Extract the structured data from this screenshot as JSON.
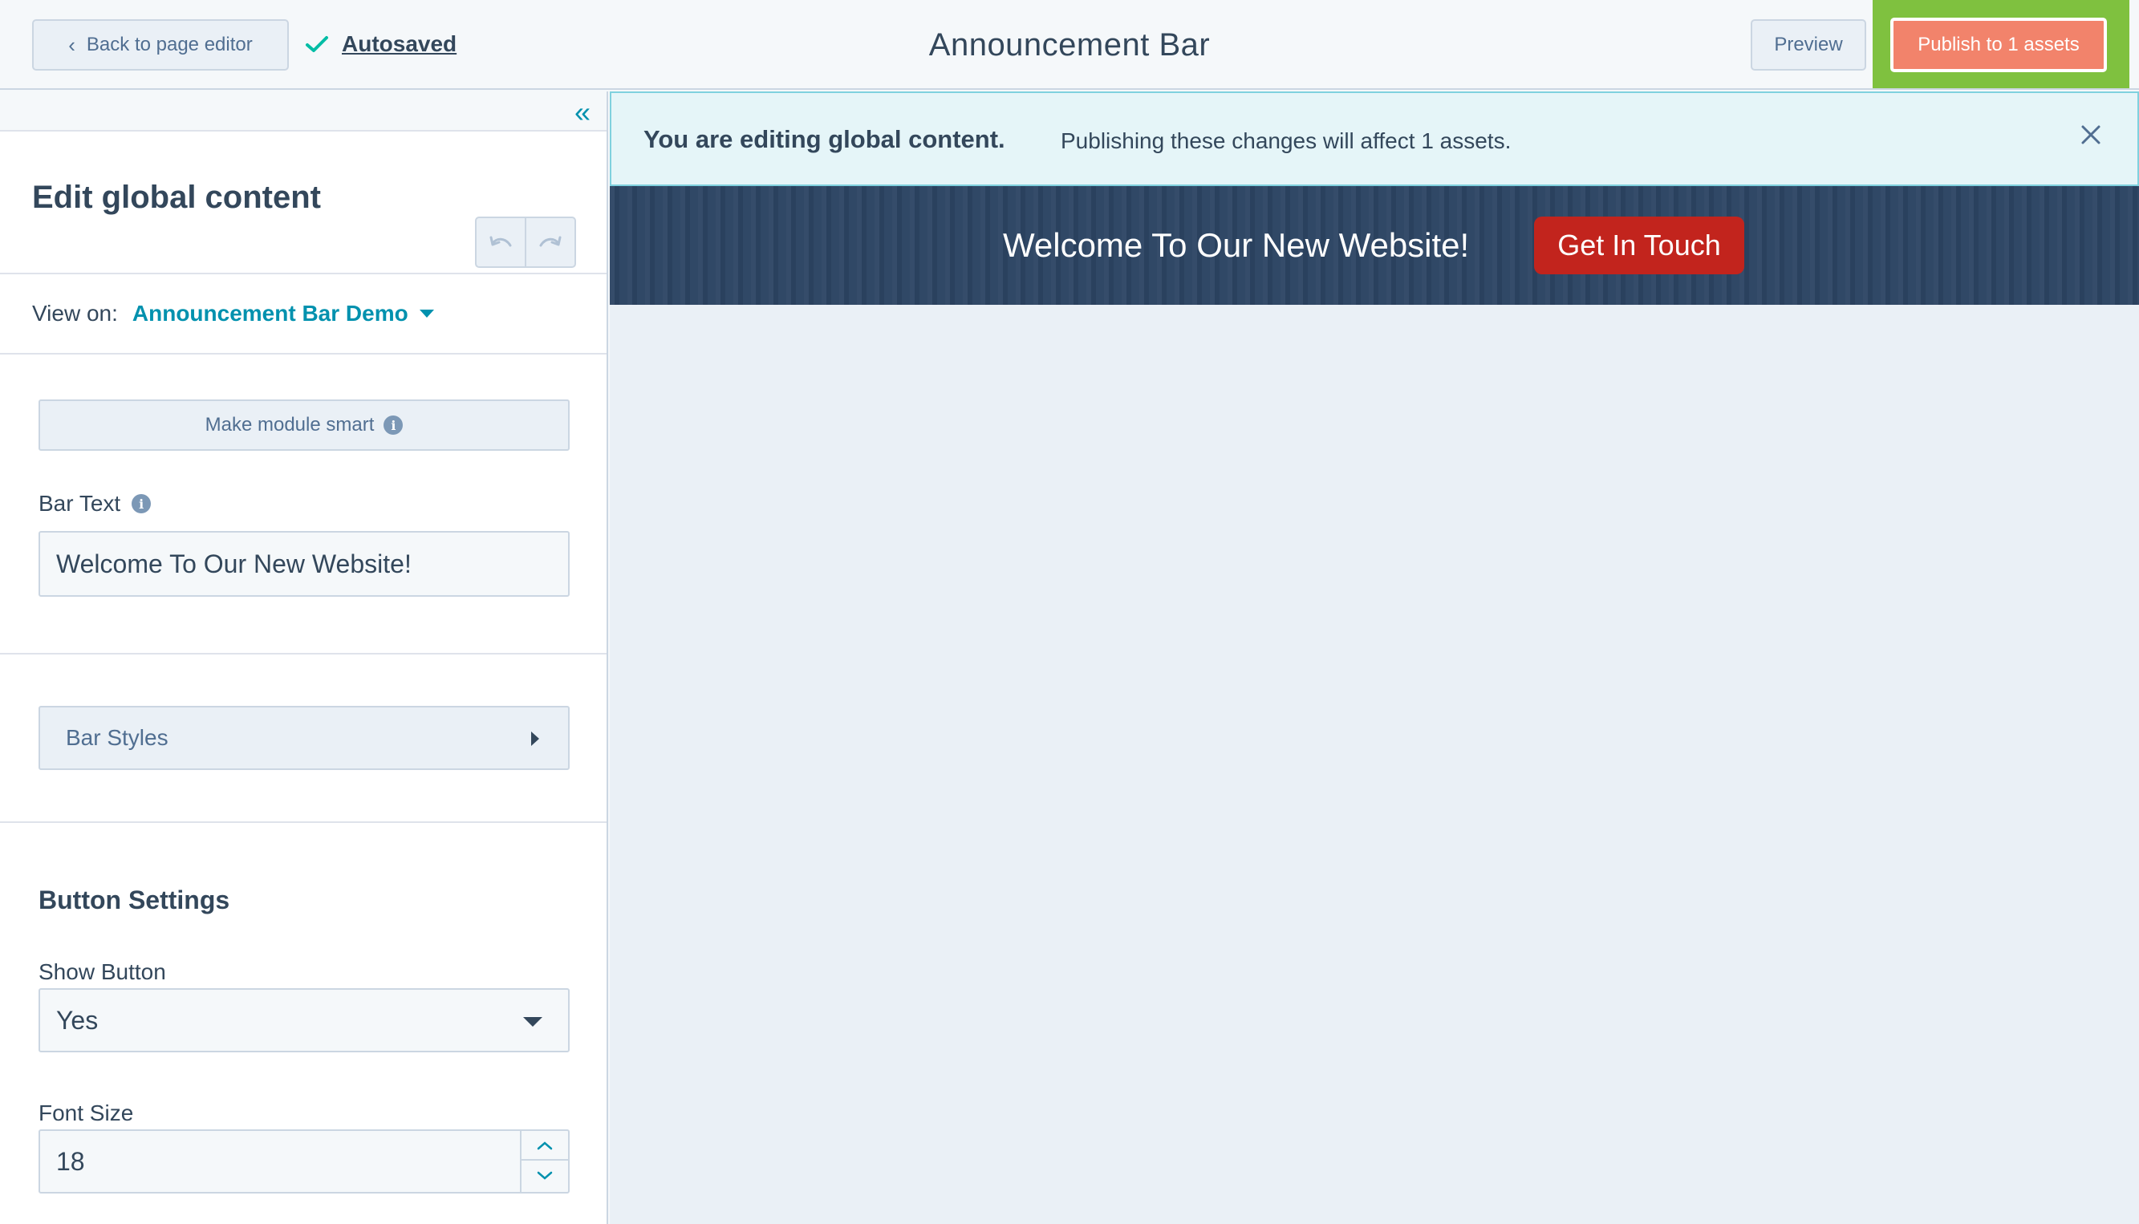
{
  "topbar": {
    "back_label": "Back to page editor",
    "autosaved_label": "Autosaved",
    "title": "Announcement Bar",
    "preview_label": "Preview",
    "publish_label": "Publish to 1 assets"
  },
  "sidebar": {
    "heading": "Edit global content",
    "view_on_label": "View on:",
    "view_on_value": "Announcement Bar Demo",
    "smart_button_label": "Make module smart",
    "bar_text_label": "Bar Text",
    "bar_text_value": "Welcome To Our New Website!",
    "bar_styles_label": "Bar Styles",
    "button_settings_heading": "Button Settings",
    "show_button_label": "Show Button",
    "show_button_value": "Yes",
    "font_size_label": "Font Size",
    "font_size_value": "18"
  },
  "banner": {
    "strong": "You are editing global content.",
    "message": "Publishing these changes will affect 1 assets."
  },
  "announcement": {
    "text": "Welcome To Our New Website!",
    "button_label": "Get In Touch"
  },
  "colors": {
    "accent": "#0091ae",
    "publish": "#f2836b",
    "highlight": "#7fc13f",
    "bar_bg": "#2c4463",
    "cta_bg": "#c2241d"
  }
}
